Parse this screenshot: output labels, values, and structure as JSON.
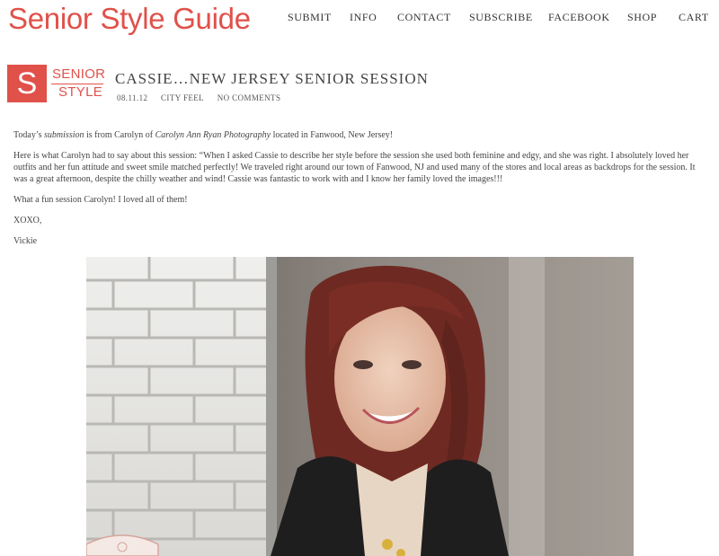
{
  "site": {
    "title": "Senior Style Guide"
  },
  "nav": {
    "items": [
      "SUBMIT",
      "INFO",
      "CONTACT",
      "SUBSCRIBE",
      "FACEBOOK",
      "SHOP",
      "CART"
    ]
  },
  "logo": {
    "letter": "S",
    "line1": "SENIOR",
    "line2": "STYLE"
  },
  "post": {
    "title": "CASSIE…NEW JERSEY SENIOR SESSION",
    "date": "08.11.12",
    "category": "CITY FEEL",
    "comments": "NO COMMENTS",
    "p1_a": "Today’s ",
    "p1_b": "submission",
    "p1_c": " is from Carolyn of ",
    "p1_d": "Carolyn Ann Ryan Photography",
    "p1_e": " located in Fanwood, New Jersey!",
    "p2": "Here is what Carolyn had to say about this session:  “When I asked Cassie to describe her style before the session she used both feminine and edgy, and she was right. I absolutely loved her outfits and her fun attitude and sweet smile matched perfectly! We traveled right around our town of Fanwood, NJ and used many of the stores and local areas as backdrops for the session. It was a great afternoon, despite the chilly weather and wind! Cassie was fantastic to work with and I know her family loved the images!!!",
    "p3": "What a fun session Carolyn!  I loved all of them!",
    "p4": "XOXO,",
    "p5": "Vickie"
  }
}
